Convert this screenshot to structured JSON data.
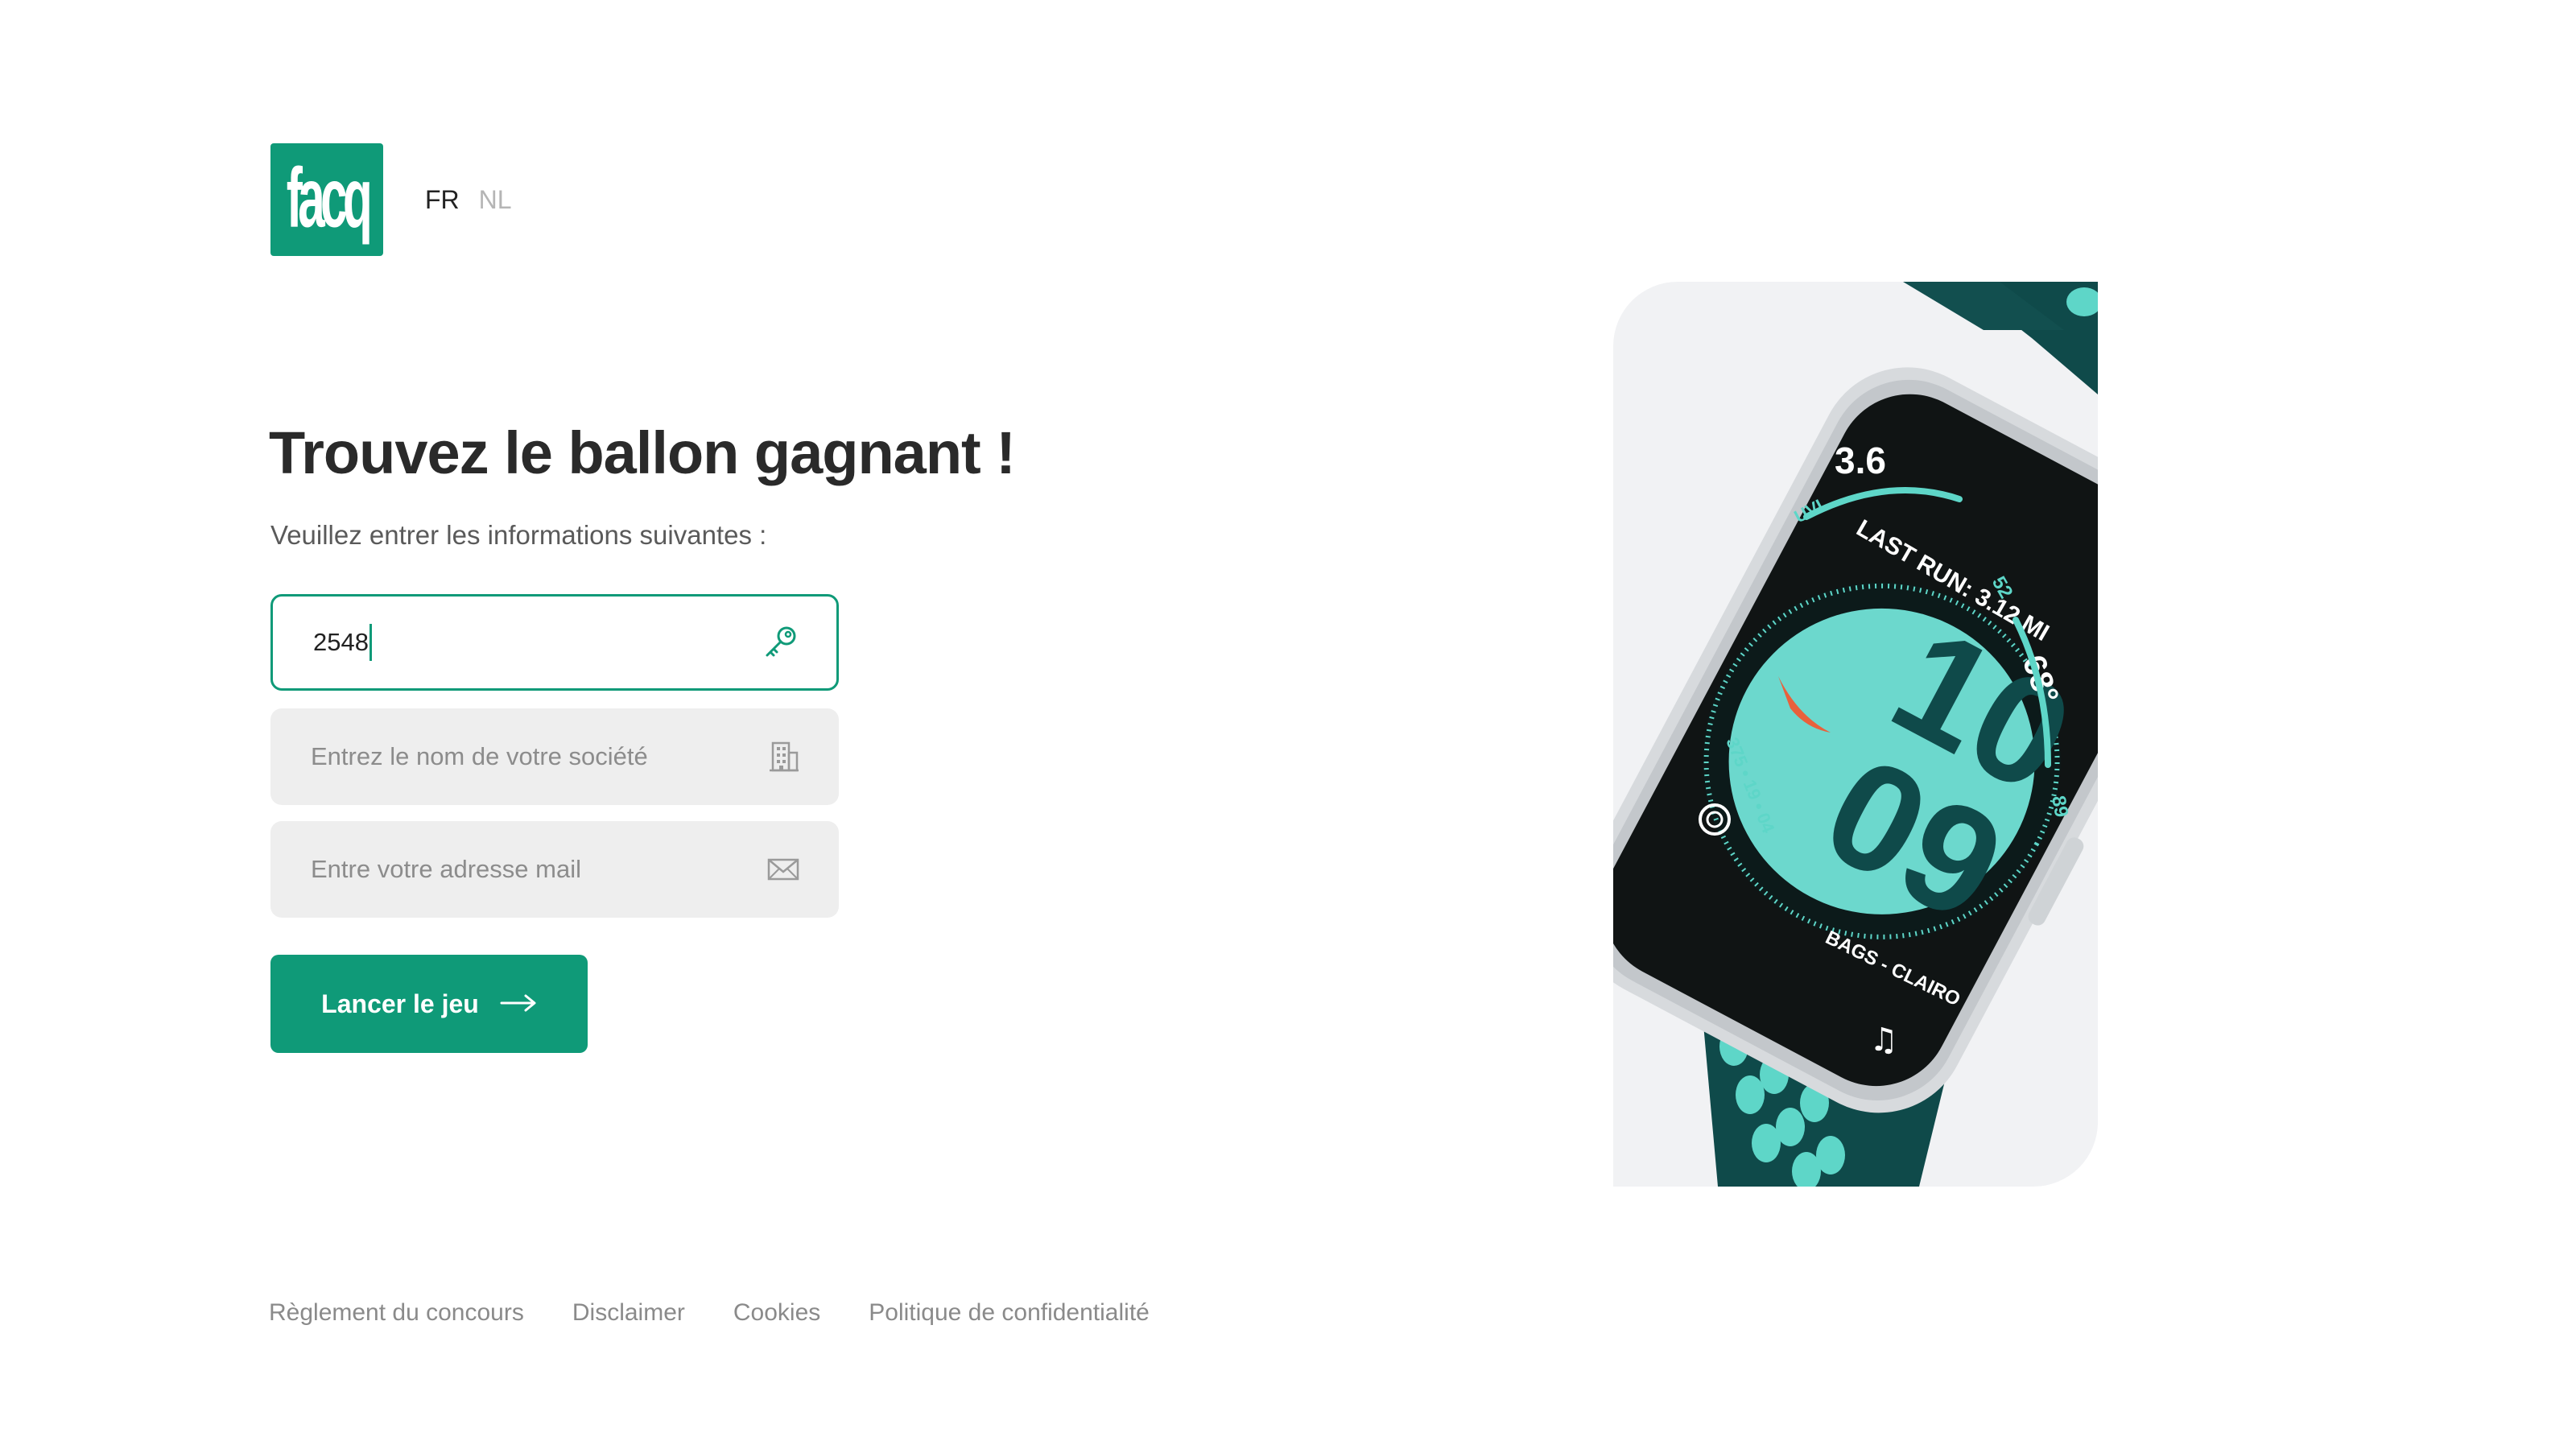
{
  "brand": {
    "logo_text": "facq",
    "color": "#0f9a78"
  },
  "language": {
    "items": [
      {
        "label": "FR",
        "active": true
      },
      {
        "label": "NL",
        "active": false
      }
    ]
  },
  "form": {
    "title": "Trouvez le ballon gagnant !",
    "subtitle": "Veuillez entrer les informations suivantes :",
    "code_field": {
      "value": "2548",
      "icon": "key-icon"
    },
    "company_field": {
      "placeholder": "Entrez le nom de votre société",
      "icon": "building-icon"
    },
    "email_field": {
      "placeholder": "Entre votre adresse mail",
      "icon": "mail-icon"
    },
    "submit_label": "Lancer le jeu"
  },
  "watch": {
    "hours": "10",
    "minutes": "09",
    "top_value": "3.6",
    "uvi_label": "UVI",
    "last_run": "LAST RUN: 3.12 MI",
    "temperature": "68°",
    "temp_low": "52",
    "temp_high": "89",
    "side_date": "375 • 19 • 04",
    "song": "BAGS - CLAIRO"
  },
  "footer": {
    "links": [
      "Règlement du concours",
      "Disclaimer",
      "Cookies",
      "Politique de confidentialité"
    ]
  }
}
